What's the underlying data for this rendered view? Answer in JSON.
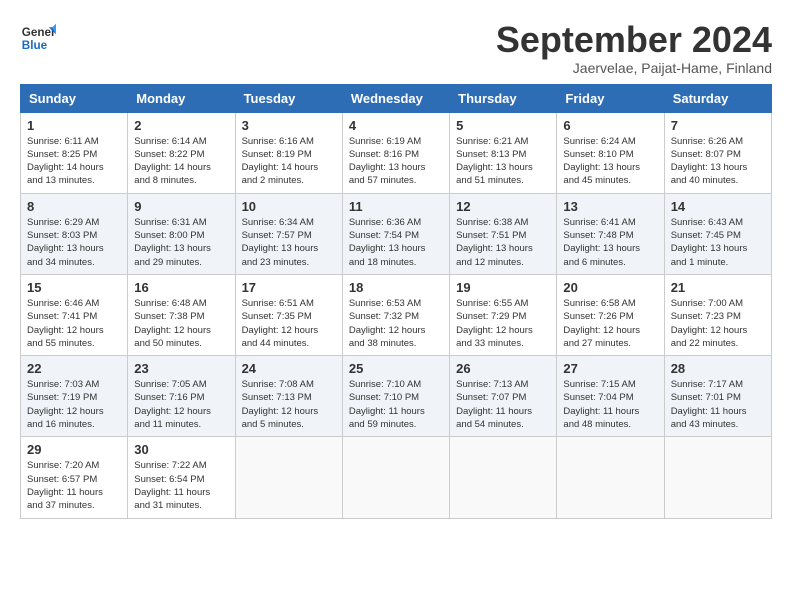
{
  "logo": {
    "general": "General",
    "blue": "Blue"
  },
  "title": "September 2024",
  "location": "Jaervelae, Paijat-Hame, Finland",
  "days_of_week": [
    "Sunday",
    "Monday",
    "Tuesday",
    "Wednesday",
    "Thursday",
    "Friday",
    "Saturday"
  ],
  "weeks": [
    [
      {
        "day": "1",
        "info": "Sunrise: 6:11 AM\nSunset: 8:25 PM\nDaylight: 14 hours\nand 13 minutes."
      },
      {
        "day": "2",
        "info": "Sunrise: 6:14 AM\nSunset: 8:22 PM\nDaylight: 14 hours\nand 8 minutes."
      },
      {
        "day": "3",
        "info": "Sunrise: 6:16 AM\nSunset: 8:19 PM\nDaylight: 14 hours\nand 2 minutes."
      },
      {
        "day": "4",
        "info": "Sunrise: 6:19 AM\nSunset: 8:16 PM\nDaylight: 13 hours\nand 57 minutes."
      },
      {
        "day": "5",
        "info": "Sunrise: 6:21 AM\nSunset: 8:13 PM\nDaylight: 13 hours\nand 51 minutes."
      },
      {
        "day": "6",
        "info": "Sunrise: 6:24 AM\nSunset: 8:10 PM\nDaylight: 13 hours\nand 45 minutes."
      },
      {
        "day": "7",
        "info": "Sunrise: 6:26 AM\nSunset: 8:07 PM\nDaylight: 13 hours\nand 40 minutes."
      }
    ],
    [
      {
        "day": "8",
        "info": "Sunrise: 6:29 AM\nSunset: 8:03 PM\nDaylight: 13 hours\nand 34 minutes."
      },
      {
        "day": "9",
        "info": "Sunrise: 6:31 AM\nSunset: 8:00 PM\nDaylight: 13 hours\nand 29 minutes."
      },
      {
        "day": "10",
        "info": "Sunrise: 6:34 AM\nSunset: 7:57 PM\nDaylight: 13 hours\nand 23 minutes."
      },
      {
        "day": "11",
        "info": "Sunrise: 6:36 AM\nSunset: 7:54 PM\nDaylight: 13 hours\nand 18 minutes."
      },
      {
        "day": "12",
        "info": "Sunrise: 6:38 AM\nSunset: 7:51 PM\nDaylight: 13 hours\nand 12 minutes."
      },
      {
        "day": "13",
        "info": "Sunrise: 6:41 AM\nSunset: 7:48 PM\nDaylight: 13 hours\nand 6 minutes."
      },
      {
        "day": "14",
        "info": "Sunrise: 6:43 AM\nSunset: 7:45 PM\nDaylight: 13 hours\nand 1 minute."
      }
    ],
    [
      {
        "day": "15",
        "info": "Sunrise: 6:46 AM\nSunset: 7:41 PM\nDaylight: 12 hours\nand 55 minutes."
      },
      {
        "day": "16",
        "info": "Sunrise: 6:48 AM\nSunset: 7:38 PM\nDaylight: 12 hours\nand 50 minutes."
      },
      {
        "day": "17",
        "info": "Sunrise: 6:51 AM\nSunset: 7:35 PM\nDaylight: 12 hours\nand 44 minutes."
      },
      {
        "day": "18",
        "info": "Sunrise: 6:53 AM\nSunset: 7:32 PM\nDaylight: 12 hours\nand 38 minutes."
      },
      {
        "day": "19",
        "info": "Sunrise: 6:55 AM\nSunset: 7:29 PM\nDaylight: 12 hours\nand 33 minutes."
      },
      {
        "day": "20",
        "info": "Sunrise: 6:58 AM\nSunset: 7:26 PM\nDaylight: 12 hours\nand 27 minutes."
      },
      {
        "day": "21",
        "info": "Sunrise: 7:00 AM\nSunset: 7:23 PM\nDaylight: 12 hours\nand 22 minutes."
      }
    ],
    [
      {
        "day": "22",
        "info": "Sunrise: 7:03 AM\nSunset: 7:19 PM\nDaylight: 12 hours\nand 16 minutes."
      },
      {
        "day": "23",
        "info": "Sunrise: 7:05 AM\nSunset: 7:16 PM\nDaylight: 12 hours\nand 11 minutes."
      },
      {
        "day": "24",
        "info": "Sunrise: 7:08 AM\nSunset: 7:13 PM\nDaylight: 12 hours\nand 5 minutes."
      },
      {
        "day": "25",
        "info": "Sunrise: 7:10 AM\nSunset: 7:10 PM\nDaylight: 11 hours\nand 59 minutes."
      },
      {
        "day": "26",
        "info": "Sunrise: 7:13 AM\nSunset: 7:07 PM\nDaylight: 11 hours\nand 54 minutes."
      },
      {
        "day": "27",
        "info": "Sunrise: 7:15 AM\nSunset: 7:04 PM\nDaylight: 11 hours\nand 48 minutes."
      },
      {
        "day": "28",
        "info": "Sunrise: 7:17 AM\nSunset: 7:01 PM\nDaylight: 11 hours\nand 43 minutes."
      }
    ],
    [
      {
        "day": "29",
        "info": "Sunrise: 7:20 AM\nSunset: 6:57 PM\nDaylight: 11 hours\nand 37 minutes."
      },
      {
        "day": "30",
        "info": "Sunrise: 7:22 AM\nSunset: 6:54 PM\nDaylight: 11 hours\nand 31 minutes."
      },
      {
        "day": "",
        "info": ""
      },
      {
        "day": "",
        "info": ""
      },
      {
        "day": "",
        "info": ""
      },
      {
        "day": "",
        "info": ""
      },
      {
        "day": "",
        "info": ""
      }
    ]
  ]
}
